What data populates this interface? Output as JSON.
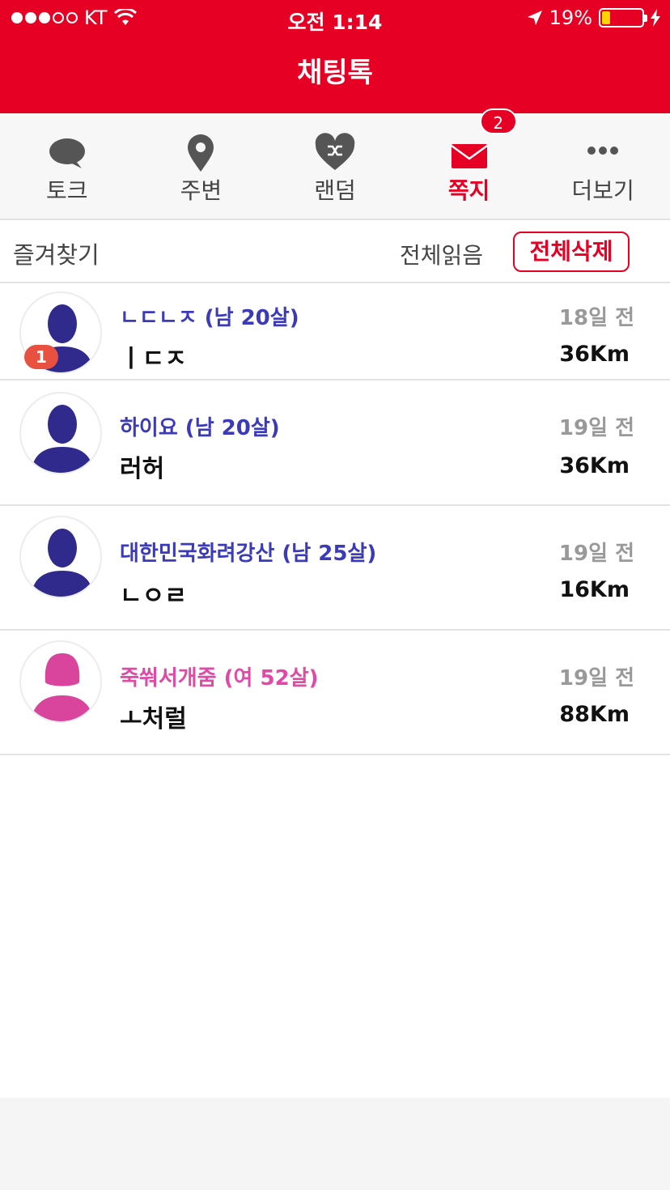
{
  "status": {
    "carrier": "KT",
    "time": "오전 1:14",
    "battery": "19%"
  },
  "header": {
    "title": "채팅톡"
  },
  "tabs": [
    {
      "label": "토크",
      "icon": "chat-bubble-icon",
      "active": false
    },
    {
      "label": "주변",
      "icon": "location-pin-icon",
      "active": false
    },
    {
      "label": "랜덤",
      "icon": "heart-shuffle-icon",
      "active": false
    },
    {
      "label": "쪽지",
      "icon": "envelope-icon",
      "active": true,
      "badge": "2"
    },
    {
      "label": "더보기",
      "icon": "more-dots-icon",
      "active": false
    }
  ],
  "toolbar": {
    "favorites": "즐겨찾기",
    "read_all": "전체읽음",
    "delete_all": "전체삭제"
  },
  "messages": [
    {
      "name": "ㄴㄷㄴㅈ (남 20살)",
      "gender": "male",
      "preview": "ㅣㄷㅈ",
      "ago": "18일 전",
      "distance": "36Km",
      "unread": "1"
    },
    {
      "name": "하이요 (남 20살)",
      "gender": "male",
      "preview": "러허",
      "ago": "19일 전",
      "distance": "36Km"
    },
    {
      "name": "대한민국화려강산 (남 25살)",
      "gender": "male",
      "preview": "ㄴㅇㄹ",
      "ago": "19일 전",
      "distance": "16Km"
    },
    {
      "name": "죽쒀서개줌 (여 52살)",
      "gender": "female",
      "preview": "ㅗ처럴",
      "ago": "19일 전",
      "distance": "88Km"
    }
  ],
  "colors": {
    "brand": "#e60023",
    "male": "#2f2a8c",
    "female": "#d9449c"
  }
}
